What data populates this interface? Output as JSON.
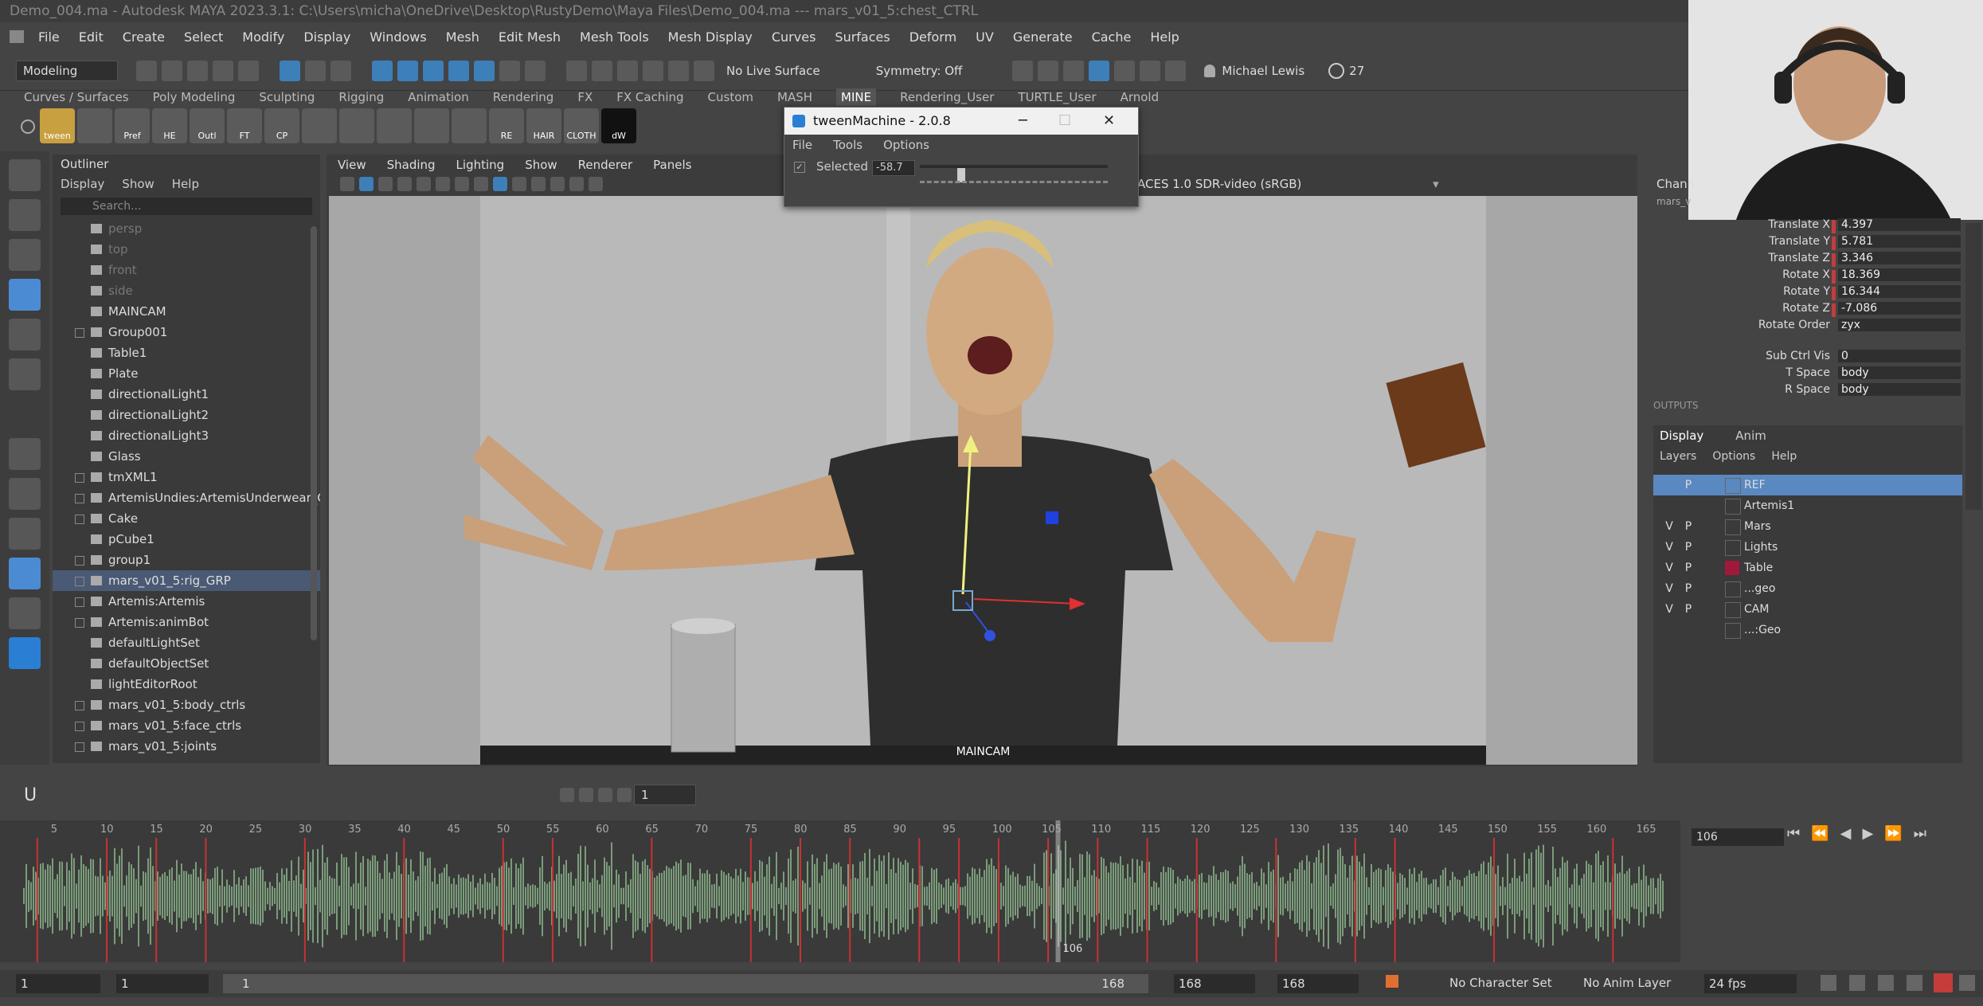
{
  "window_title": "Demo_004.ma - Autodesk MAYA 2023.3.1: C:\\Users\\micha\\OneDrive\\Desktop\\RustyDemo\\Maya Files\\Demo_004.ma  ---  mars_v01_5:chest_CTRL",
  "menus": [
    "File",
    "Edit",
    "Create",
    "Select",
    "Modify",
    "Display",
    "Windows",
    "Mesh",
    "Edit Mesh",
    "Mesh Tools",
    "Mesh Display",
    "Curves",
    "Surfaces",
    "Deform",
    "UV",
    "Generate",
    "Cache",
    "Help"
  ],
  "status_line": {
    "mode": "Modeling",
    "live_surface": "No Live Surface",
    "symmetry": "Symmetry: Off",
    "user": "Michael Lewis",
    "counter": "27"
  },
  "shelf_tabs": [
    "Curves / Surfaces",
    "Poly Modeling",
    "Sculpting",
    "Rigging",
    "Animation",
    "Rendering",
    "FX",
    "FX Caching",
    "Custom",
    "MASH",
    "MINE",
    "Rendering_User",
    "TURTLE_User",
    "Arnold"
  ],
  "shelf_active": "MINE",
  "shelf_buttons": [
    "tween",
    "",
    "Pref",
    "HE",
    "Outl",
    "FT",
    "CP",
    "",
    "",
    "",
    "",
    "",
    "RE",
    "HAIR",
    "CLOTH",
    "dW"
  ],
  "outliner": {
    "title": "Outliner",
    "menu": [
      "Display",
      "Show",
      "Help"
    ],
    "search_placeholder": "Search...",
    "items": [
      {
        "label": "persp",
        "dim": true,
        "expand": false
      },
      {
        "label": "top",
        "dim": true,
        "expand": false
      },
      {
        "label": "front",
        "dim": true,
        "expand": false
      },
      {
        "label": "side",
        "dim": true,
        "expand": false
      },
      {
        "label": "MAINCAM",
        "dim": false,
        "expand": false
      },
      {
        "label": "Group001",
        "dim": false,
        "expand": true
      },
      {
        "label": "Table1",
        "dim": false,
        "expand": false
      },
      {
        "label": "Plate",
        "dim": false,
        "expand": false
      },
      {
        "label": "directionalLight1",
        "dim": false,
        "expand": false
      },
      {
        "label": "directionalLight2",
        "dim": false,
        "expand": false
      },
      {
        "label": "directionalLight3",
        "dim": false,
        "expand": false
      },
      {
        "label": "Glass",
        "dim": false,
        "expand": false
      },
      {
        "label": "tmXML1",
        "dim": false,
        "expand": true
      },
      {
        "label": "ArtemisUndies:ArtemisUnderwear_GR",
        "dim": false,
        "expand": true
      },
      {
        "label": "Cake",
        "dim": false,
        "expand": true
      },
      {
        "label": "pCube1",
        "dim": false,
        "expand": false
      },
      {
        "label": "group1",
        "dim": false,
        "expand": true
      },
      {
        "label": "mars_v01_5:rig_GRP",
        "dim": false,
        "expand": true,
        "selected": true
      },
      {
        "label": "Artemis:Artemis",
        "dim": false,
        "expand": true
      },
      {
        "label": "Artemis:animBot",
        "dim": false,
        "expand": true
      },
      {
        "label": "defaultLightSet",
        "dim": false,
        "expand": false
      },
      {
        "label": "defaultObjectSet",
        "dim": false,
        "expand": false
      },
      {
        "label": "lightEditorRoot",
        "dim": false,
        "expand": false
      },
      {
        "label": "mars_v01_5:body_ctrls",
        "dim": false,
        "expand": true
      },
      {
        "label": "mars_v01_5:face_ctrls",
        "dim": false,
        "expand": true
      },
      {
        "label": "mars_v01_5:joints",
        "dim": false,
        "expand": true
      }
    ]
  },
  "viewport": {
    "menu": [
      "View",
      "Shading",
      "Lighting",
      "Show",
      "Renderer",
      "Panels"
    ],
    "color_space": "ACES 1.0 SDR-video (sRGB)",
    "camera_label": "MAINCAM"
  },
  "tween_machine": {
    "title": "tweenMachine - 2.0.8",
    "menu": [
      "File",
      "Tools",
      "Options"
    ],
    "selected_label": "Selected",
    "value": "-58.7",
    "slider_fraction": 0.21
  },
  "channel_box": {
    "header": "Chann",
    "object": "mars_v",
    "channels": [
      {
        "name": "Translate X",
        "value": "4.397",
        "keyed": true
      },
      {
        "name": "Translate Y",
        "value": "5.781",
        "keyed": true
      },
      {
        "name": "Translate Z",
        "value": "3.346",
        "keyed": true
      },
      {
        "name": "Rotate X",
        "value": "18.369",
        "keyed": true
      },
      {
        "name": "Rotate Y",
        "value": "16.344",
        "keyed": true
      },
      {
        "name": "Rotate Z",
        "value": "-7.086",
        "keyed": true
      },
      {
        "name": "Rotate Order",
        "value": "zyx",
        "keyed": false
      },
      {
        "name": "Sub Ctrl Vis",
        "value": "0",
        "keyed": false
      },
      {
        "name": "T Space",
        "value": "body",
        "keyed": false
      },
      {
        "name": "R Space",
        "value": "body",
        "keyed": false
      }
    ],
    "outputs_label": "OUTPUTS"
  },
  "layer_editor": {
    "tabs": [
      "Display",
      "Anim"
    ],
    "menu": [
      "Layers",
      "Options",
      "Help"
    ],
    "layers": [
      {
        "v": "",
        "p": "P",
        "name": "REF",
        "selected": true,
        "color": ""
      },
      {
        "v": "",
        "p": "",
        "name": "Artemis1",
        "selected": false,
        "color": ""
      },
      {
        "v": "V",
        "p": "P",
        "name": "Mars",
        "selected": false,
        "color": ""
      },
      {
        "v": "V",
        "p": "P",
        "name": "Lights",
        "selected": false,
        "color": ""
      },
      {
        "v": "V",
        "p": "P",
        "name": "Table",
        "selected": false,
        "color": "#a0183a"
      },
      {
        "v": "V",
        "p": "P",
        "name": "...geo",
        "selected": false,
        "color": ""
      },
      {
        "v": "V",
        "p": "P",
        "name": "CAM",
        "selected": false,
        "color": ""
      },
      {
        "v": "",
        "p": "",
        "name": "...:Geo",
        "selected": false,
        "color": ""
      }
    ]
  },
  "timeline": {
    "current_frame_field": "1",
    "frame_ticks": [
      "5",
      "10",
      "15",
      "20",
      "25",
      "30",
      "35",
      "40",
      "45",
      "50",
      "55",
      "60",
      "65",
      "70",
      "75",
      "80",
      "85",
      "90",
      "95",
      "100",
      "105",
      "110",
      "115",
      "120",
      "125",
      "130",
      "135",
      "140",
      "145",
      "150",
      "155",
      "160",
      "165"
    ],
    "current_frame": "106",
    "playhead_frame": 106,
    "start": 1,
    "end": 168,
    "key_frames": [
      3,
      10,
      15,
      20,
      30,
      40,
      50,
      55,
      65,
      75,
      80,
      85,
      92,
      96,
      100,
      105,
      110,
      115,
      120,
      128,
      136,
      140,
      150,
      162
    ]
  },
  "range_bar": {
    "start": "1",
    "start_inner": "1",
    "range_start": "1",
    "end_inner": "168",
    "end": "168",
    "end_outer": "168",
    "character_set": "No Character Set",
    "anim_layer": "No Anim Layer",
    "fps": "24 fps"
  }
}
